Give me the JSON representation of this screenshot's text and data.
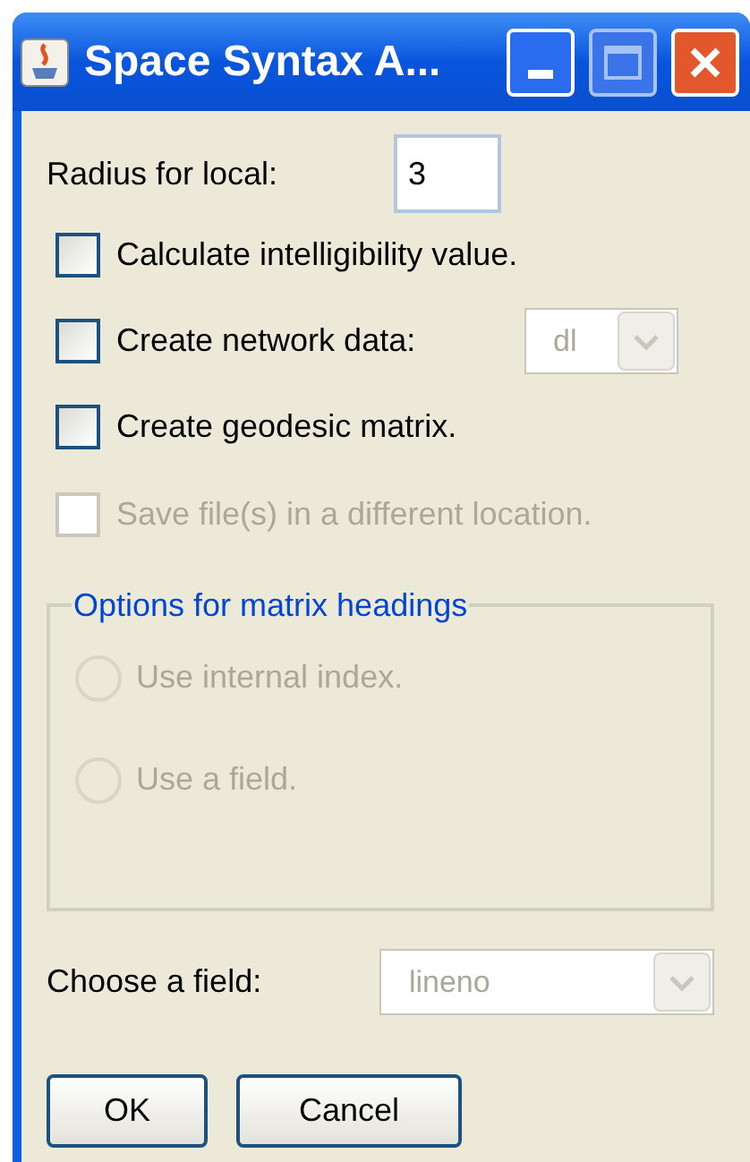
{
  "window": {
    "title": "Space Syntax A..."
  },
  "radius": {
    "label": "Radius for local:",
    "value": "3"
  },
  "checkboxes": [
    {
      "kind": "checkbox",
      "label": "Calculate intelligibility value.",
      "checked": false,
      "disabled": false
    },
    {
      "kind": "combo",
      "label": "Create network data:",
      "checked": false,
      "disabled": false,
      "combo": {
        "value": "dl",
        "disabled": true
      }
    },
    {
      "kind": "checkbox",
      "label": "Create geodesic matrix.",
      "checked": false,
      "disabled": false
    },
    {
      "kind": "checkbox",
      "label": "Save file(s) in a different location.",
      "checked": false,
      "disabled": true
    }
  ],
  "group": {
    "title": "Options for matrix headings",
    "radios": [
      {
        "label": "Use internal index.",
        "selected": false,
        "disabled": true
      },
      {
        "label": "Use a field.",
        "selected": false,
        "disabled": true
      }
    ]
  },
  "choose_field": {
    "label": "Choose a field:",
    "value": "lineno",
    "disabled": true
  },
  "buttons": [
    "OK",
    "Cancel"
  ]
}
